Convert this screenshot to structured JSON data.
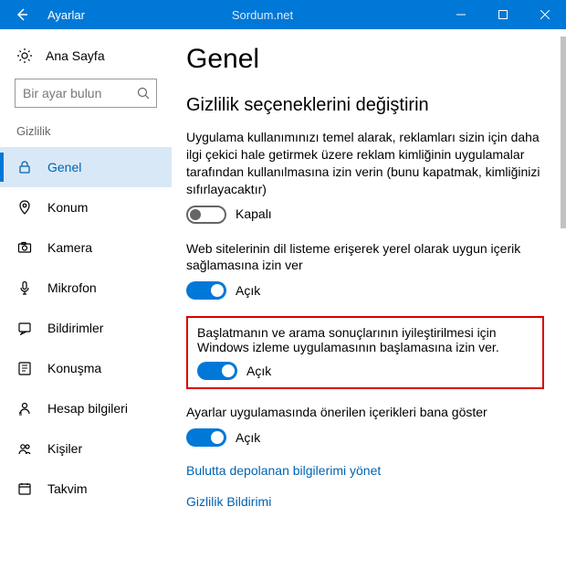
{
  "titlebar": {
    "title": "Ayarlar",
    "watermark": "Sordum.net"
  },
  "sidebar": {
    "home": "Ana Sayfa",
    "search_placeholder": "Bir ayar bulun",
    "section": "Gizlilik",
    "items": [
      {
        "label": "Genel"
      },
      {
        "label": "Konum"
      },
      {
        "label": "Kamera"
      },
      {
        "label": "Mikrofon"
      },
      {
        "label": "Bildirimler"
      },
      {
        "label": "Konuşma"
      },
      {
        "label": "Hesap bilgileri"
      },
      {
        "label": "Kişiler"
      },
      {
        "label": "Takvim"
      }
    ]
  },
  "content": {
    "heading": "Genel",
    "subheading": "Gizlilik seçeneklerini değiştirin",
    "s0": {
      "desc": "Uygulama kullanımınızı temel alarak, reklamları sizin için daha ilgi çekici hale getirmek üzere reklam kimliğinin uygulamalar tarafından kullanılmasına izin verin (bunu kapatmak, kimliğinizi sıfırlayacaktır)",
      "state": "Kapalı"
    },
    "s1": {
      "desc": "Web sitelerinin dil listeme erişerek yerel olarak uygun içerik sağlamasına izin ver",
      "state": "Açık"
    },
    "s2": {
      "desc": "Başlatmanın ve arama sonuçlarının iyileştirilmesi için Windows izleme uygulamasının başlamasına izin ver.",
      "state": "Açık"
    },
    "s3": {
      "desc": "Ayarlar uygulamasında önerilen içerikleri bana göster",
      "state": "Açık"
    },
    "link0": "Bulutta depolanan bilgilerimi yönet",
    "link1": "Gizlilik Bildirimi"
  }
}
